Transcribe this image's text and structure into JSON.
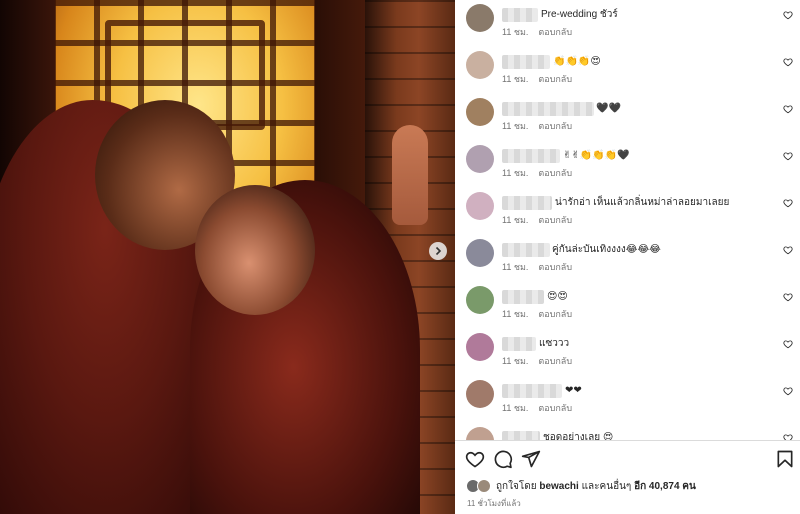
{
  "post": {
    "carousel_next_icon": "chevron-right-icon"
  },
  "comments": [
    {
      "text": "Pre-wedding ชัวร์",
      "time": "11 ชม.",
      "reply": "ตอบกลับ",
      "avatar_color": "#8a7a6a"
    },
    {
      "text": "👏👏👏😍",
      "time": "11 ชม.",
      "reply": "ตอบกลับ",
      "avatar_color": "#c9b0a0"
    },
    {
      "text": "🖤🖤",
      "time": "11 ชม.",
      "reply": "ตอบกลับ",
      "avatar_color": "#a08060"
    },
    {
      "text": "✌✌👏👏👏🖤",
      "time": "11 ชม.",
      "reply": "ตอบกลับ",
      "avatar_color": "#b0a0b0"
    },
    {
      "text": "น่ารักอ่า เห็นแล้วกลิ่นหม่าล่าลอยมาเลยย",
      "time": "11 ชม.",
      "reply": "ตอบกลับ",
      "avatar_color": "#d0b0c0"
    },
    {
      "text": "คู่กันล่ะบันเทิงงงง😂😂😂",
      "time": "11 ชม.",
      "reply": "ตอบกลับ",
      "avatar_color": "#8a8a9a"
    },
    {
      "text": "😍😍",
      "time": "11 ชม.",
      "reply": "ตอบกลับ",
      "avatar_color": "#7a9a6a"
    },
    {
      "text": "แซววว",
      "time": "11 ชม.",
      "reply": "ตอบกลับ",
      "avatar_color": "#b07a9a"
    },
    {
      "text": "❤❤",
      "time": "11 ชม.",
      "reply": "ตอบกลับ",
      "avatar_color": "#a07a6a"
    },
    {
      "text": "ชอดอย่างเลย 😍",
      "time": "",
      "reply": "",
      "avatar_color": "#c0a090"
    }
  ],
  "actions": {
    "like_icon": "heart-icon",
    "comment_icon": "comment-icon",
    "share_icon": "share-icon",
    "save_icon": "bookmark-icon"
  },
  "likes": {
    "prefix": "ถูกใจโดย ",
    "user": "bewachi",
    "middle": " และคนอื่นๆ ",
    "count": "อีก 40,874 คน"
  },
  "timestamp": "11 ชั่วโมงที่แล้ว",
  "colors": {
    "text_primary": "#262626",
    "text_secondary": "#737373",
    "divider": "#dbdbdb"
  }
}
